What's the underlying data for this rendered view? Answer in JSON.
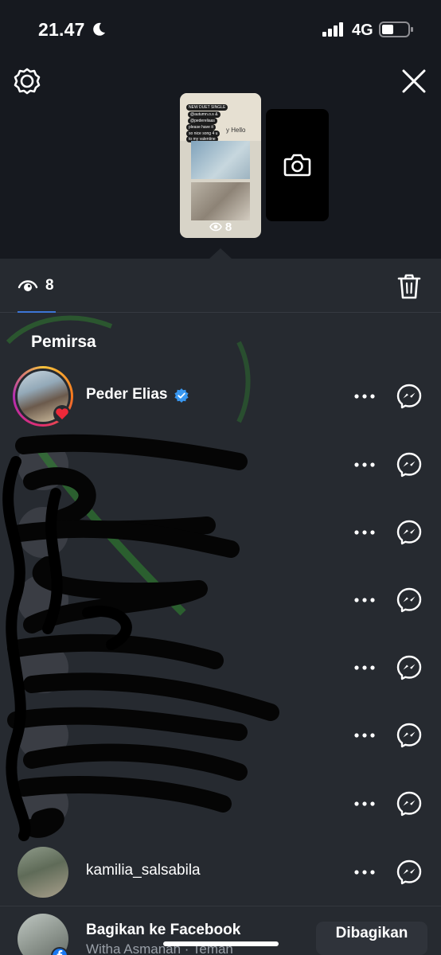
{
  "status_bar": {
    "time": "21.47",
    "network": "4G"
  },
  "story": {
    "thumb_views": "8",
    "thumb_chips": [
      "NEW DUET SINGLE",
      "@autumn.o.s &",
      "@pedereliaas",
      "please have it",
      "so nice song 4 u",
      "to my valentine"
    ],
    "thumb_text": "y Hello"
  },
  "stats": {
    "view_count": "8"
  },
  "viewers": {
    "section_title": "Pemirsa",
    "items": [
      {
        "name": "Peder Elias",
        "verified": true,
        "liked": true
      },
      {
        "name": ""
      },
      {
        "name": ""
      },
      {
        "name": ""
      },
      {
        "name": ""
      },
      {
        "name": ""
      },
      {
        "name": ""
      },
      {
        "name": "kamilia_salsabila"
      }
    ]
  },
  "share": {
    "title": "Bagikan ke Facebook",
    "subtitle": "Witha Asmanah · Teman",
    "button_label": "Dibagikan"
  },
  "colors": {
    "background": "#262a30",
    "top_background": "#16191f",
    "accent_blue": "#3d75d6",
    "verified_blue": "#3897f0",
    "heart_red": "#ed2939",
    "facebook_blue": "#1877f2"
  },
  "icons": {
    "settings": "settings-icon",
    "close": "close-icon",
    "camera": "camera-icon",
    "eye": "eye-icon",
    "trash": "trash-icon",
    "more": "more-dots-icon",
    "messenger": "messenger-icon"
  }
}
